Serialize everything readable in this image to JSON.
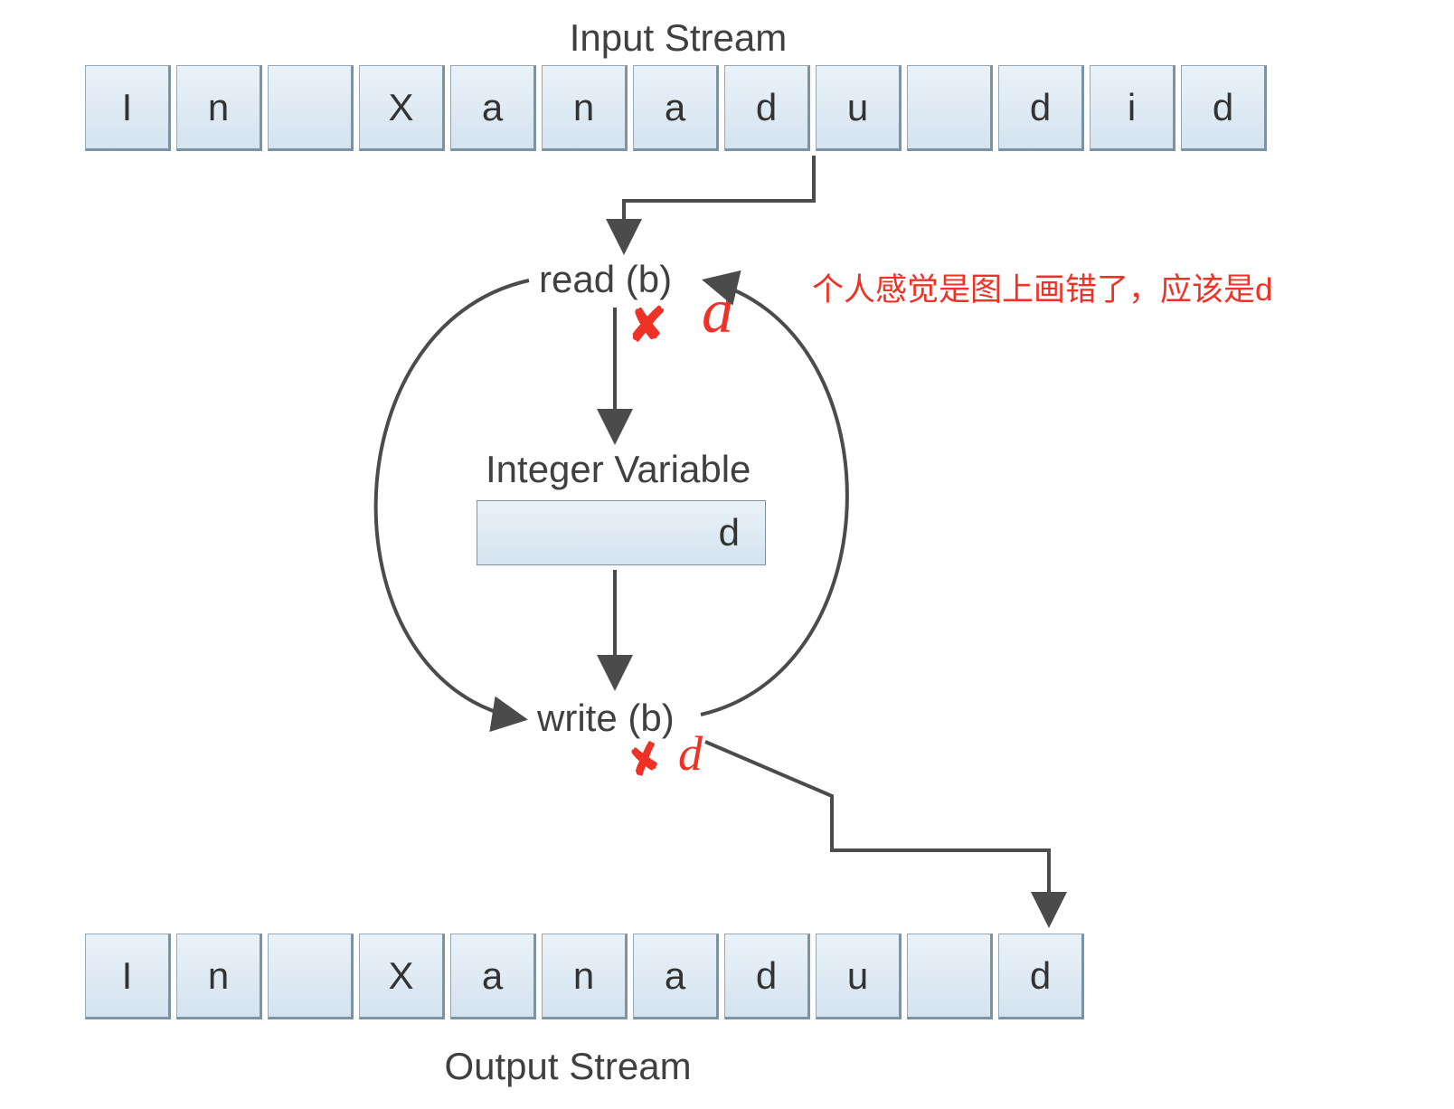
{
  "titles": {
    "input": "Input Stream",
    "output": "Output Stream"
  },
  "input_cells": [
    "I",
    "n",
    "",
    "X",
    "a",
    "n",
    "a",
    "d",
    "u",
    "",
    "d",
    "i",
    "d"
  ],
  "output_cells": [
    "I",
    "n",
    "",
    "X",
    "a",
    "n",
    "a",
    "d",
    "u",
    "",
    "d"
  ],
  "labels": {
    "read": "read (b)",
    "integer_variable": "Integer Variable",
    "var_value": "d",
    "write": "write (b)"
  },
  "annotations": {
    "comment": "个人感觉是图上画错了，应该是d",
    "hand_d_top": "d",
    "hand_d_bottom": "d",
    "x_top": "✘",
    "x_bottom": "✘"
  },
  "watermark": ""
}
